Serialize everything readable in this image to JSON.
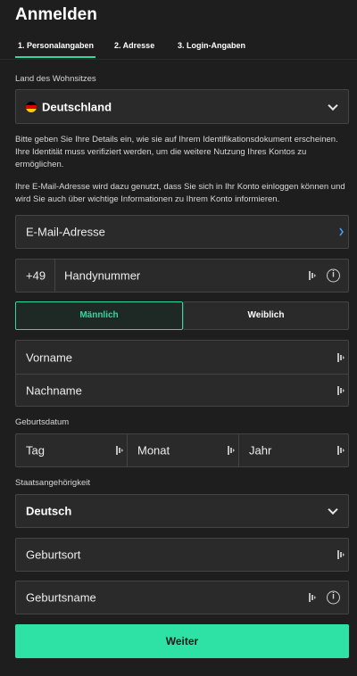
{
  "header": {
    "title": "Anmelden"
  },
  "steps": [
    {
      "label": "1. Personalangaben"
    },
    {
      "label": "2. Adresse"
    },
    {
      "label": "3. Login-Angaben"
    }
  ],
  "country": {
    "label": "Land des Wohnsitzes",
    "value": "Deutschland"
  },
  "info": {
    "para1": "Bitte geben Sie Ihre Details ein, wie sie auf Ihrem Identifikationsdokument erscheinen. Ihre Identität muss verifiziert werden, um die weitere Nutzung Ihres Kontos zu ermöglichen.",
    "para2": "Ihre E-Mail-Adresse wird dazu genutzt, dass Sie sich in Ihr Konto einloggen können und wird Sie auch über wichtige Informationen zu Ihrem Konto informieren."
  },
  "email": {
    "placeholder": "E-Mail-Adresse"
  },
  "phone": {
    "prefix": "+49",
    "placeholder": "Handynummer"
  },
  "gender": {
    "male": "Männlich",
    "female": "Weiblich"
  },
  "name": {
    "first_placeholder": "Vorname",
    "last_placeholder": "Nachname"
  },
  "birthdate": {
    "label": "Geburtsdatum",
    "day": "Tag",
    "month": "Monat",
    "year": "Jahr"
  },
  "nationality": {
    "label": "Staatsangehörigkeit",
    "value": "Deutsch"
  },
  "birthplace": {
    "placeholder": "Geburtsort"
  },
  "birthname": {
    "placeholder": "Geburtsname"
  },
  "submit": {
    "label": "Weiter"
  },
  "colors": {
    "accent": "#2ee2a6",
    "background": "#1e1e1e",
    "field": "#2a2a2a"
  }
}
